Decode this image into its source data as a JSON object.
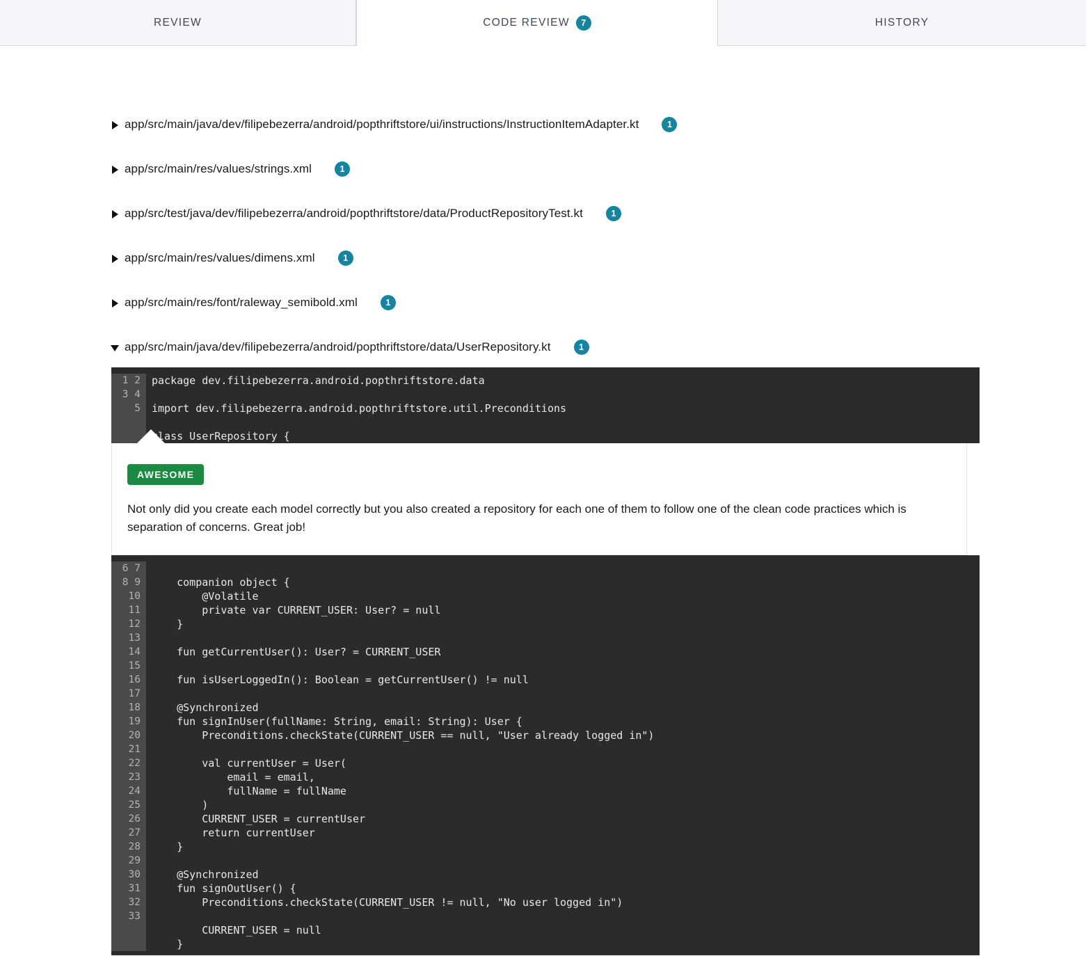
{
  "tabs": [
    {
      "label": "REVIEW",
      "badge": null,
      "active": false
    },
    {
      "label": "CODE REVIEW",
      "badge": "7",
      "active": true
    },
    {
      "label": "HISTORY",
      "badge": null,
      "active": false
    }
  ],
  "files": [
    {
      "path": "app/src/main/java/dev/filipebezerra/android/popthriftstore/ui/instructions/InstructionItemAdapter.kt",
      "count": "1",
      "expanded": false
    },
    {
      "path": "app/src/main/res/values/strings.xml",
      "count": "1",
      "expanded": false
    },
    {
      "path": "app/src/test/java/dev/filipebezerra/android/popthriftstore/data/ProductRepositoryTest.kt",
      "count": "1",
      "expanded": false
    },
    {
      "path": "app/src/main/res/values/dimens.xml",
      "count": "1",
      "expanded": false
    },
    {
      "path": "app/src/main/res/font/raleway_semibold.xml",
      "count": "1",
      "expanded": false
    },
    {
      "path": "app/src/main/java/dev/filipebezerra/android/popthriftstore/data/UserRepository.kt",
      "count": "1",
      "expanded": true
    }
  ],
  "code_top": {
    "line_numbers": "1\n2\n3\n4\n5",
    "lines": "package dev.filipebezerra.android.popthriftstore.data\n\nimport dev.filipebezerra.android.popthriftstore.util.Preconditions\n\nclass UserRepository {"
  },
  "comment": {
    "chip_label": "AWESOME",
    "body": "Not only did you create each model correctly but you also created a repository for each one of them to follow one of the clean code practices which is separation of concerns. Great job!"
  },
  "code_bottom": {
    "line_numbers": "6\n7\n8\n9\n10\n11\n12\n13\n14\n15\n16\n17\n18\n19\n20\n21\n22\n23\n24\n25\n26\n27\n28\n29\n30\n31\n32\n33",
    "lines": "\n    companion object {\n        @Volatile\n        private var CURRENT_USER: User? = null\n    }\n\n    fun getCurrentUser(): User? = CURRENT_USER\n\n    fun isUserLoggedIn(): Boolean = getCurrentUser() != null\n\n    @Synchronized\n    fun signInUser(fullName: String, email: String): User {\n        Preconditions.checkState(CURRENT_USER == null, \"User already logged in\")\n\n        val currentUser = User(\n            email = email,\n            fullName = fullName\n        )\n        CURRENT_USER = currentUser\n        return currentUser\n    }\n\n    @Synchronized\n    fun signOutUser() {\n        Preconditions.checkState(CURRENT_USER != null, \"No user logged in\")\n\n        CURRENT_USER = null\n    }"
  },
  "colors": {
    "badge_teal": "#1484a0",
    "chip_green": "#1b8a43",
    "code_bg": "#2b2b2b",
    "gutter_bg": "#4a4a4a",
    "tab_inactive_bg": "#f8f5fa"
  }
}
